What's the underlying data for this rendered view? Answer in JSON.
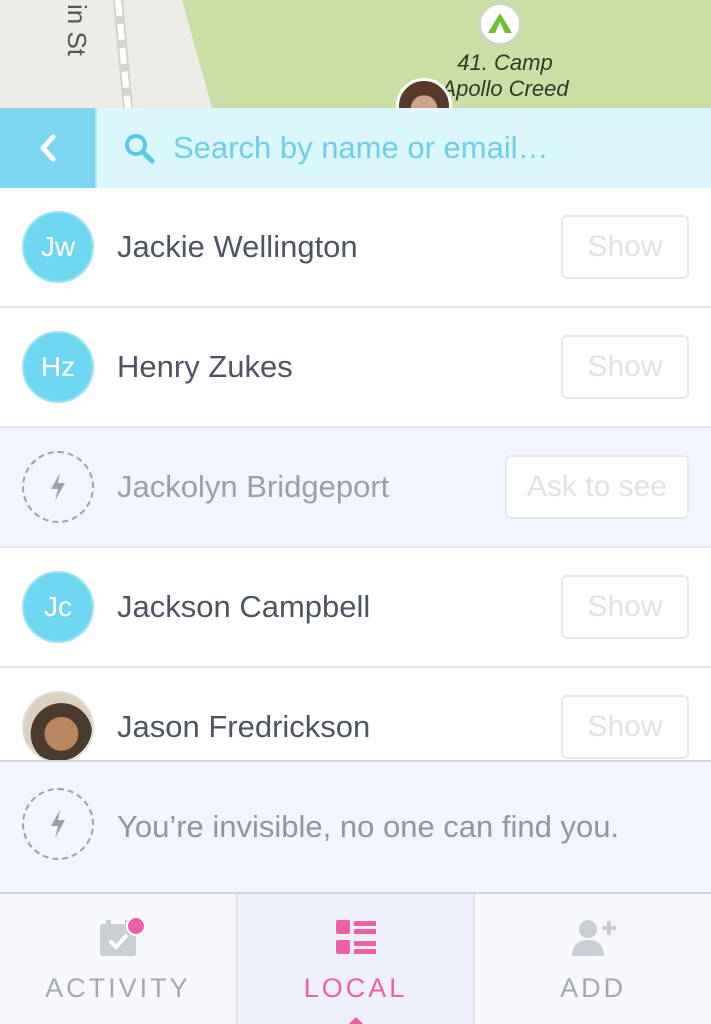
{
  "map": {
    "street_label": "in St",
    "camp_label_line1": "41. Camp",
    "camp_label_line2": "Apollo Creed"
  },
  "search": {
    "placeholder": "Search by name or email…"
  },
  "contacts": [
    {
      "initials": "Jw",
      "name": "Jackie Wellington",
      "action": "Show"
    },
    {
      "initials": "Hz",
      "name": "Henry Zukes",
      "action": "Show"
    },
    {
      "initials": "",
      "name": "Jackolyn Bridgeport",
      "action": "Ask to see"
    },
    {
      "initials": "Jc",
      "name": "Jackson Campbell",
      "action": "Show"
    },
    {
      "initials": "",
      "name": "Jason Fredrickson",
      "action": "Show"
    }
  ],
  "notice": {
    "text": "You’re invisible, no one can find you."
  },
  "tabs": [
    {
      "label": "ACTIVITY",
      "icon": "calendar-check-icon"
    },
    {
      "label": "LOCAL",
      "icon": "list-icon"
    },
    {
      "label": "ADD",
      "icon": "add-user-icon"
    }
  ],
  "colors": {
    "accent": "#ee5fa7",
    "header": "#7dd6f0",
    "avatar": "#6fd6f1"
  }
}
